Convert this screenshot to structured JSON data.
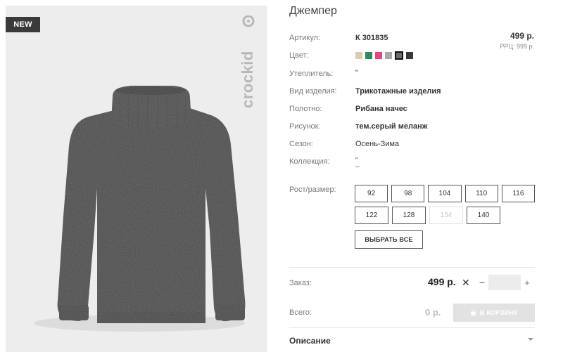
{
  "product": {
    "badge": "NEW",
    "brand_logo": "crockid",
    "title": "Джемпер"
  },
  "price": {
    "main": "499 р.",
    "rrc": "РРЦ: 999 р."
  },
  "details": {
    "article_label": "Артикул:",
    "article_value": "К 301835",
    "color_label": "Цвет:",
    "colors": [
      "#d8cbb0",
      "#2f8a5b",
      "#e2457f",
      "#a8a8a8",
      "#6b6b6b",
      "#3a3a3a"
    ],
    "selected_color_index": 4,
    "insulation_label": "Утеплитель:",
    "insulation_value": "\"",
    "type_label": "Вид изделия:",
    "type_value": "Трикотажные изделия",
    "fabric_label": "Полотно:",
    "fabric_value": "Рибана начес",
    "pattern_label": "Рисунок:",
    "pattern_value": "тем.серый меланж",
    "season_label": "Сезон:",
    "season_value": "Осень-Зима",
    "collection_label": "Коллекция:",
    "collection_line1": "\"",
    "collection_line2": "–"
  },
  "sizes": {
    "label": "Рост/размер:",
    "row1": [
      "92",
      "98",
      "104",
      "110",
      "116"
    ],
    "row2": [
      "122",
      "128",
      "134",
      "140"
    ],
    "disabled": [
      "134"
    ],
    "select_all": "ВЫБРАТЬ ВСЕ"
  },
  "order": {
    "label": "Заказ:",
    "price": "499 р.",
    "times": "✕",
    "minus": "−",
    "plus": "+",
    "quantity": ""
  },
  "total": {
    "label": "Всего:",
    "value": "0 р.",
    "cart_button": "В КОРЗИНУ"
  },
  "description": {
    "title": "Описание"
  }
}
